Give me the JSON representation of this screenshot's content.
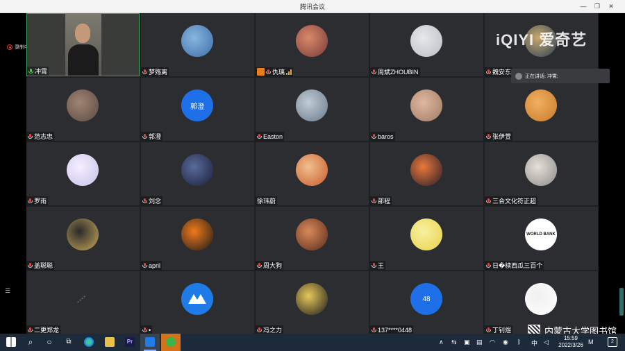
{
  "window": {
    "title": "腾讯会议"
  },
  "recording": {
    "label": "录制中"
  },
  "speaking": {
    "label": "正在讲话: 冲霄;"
  },
  "watermark": {
    "text": "iQIYI 爱奇艺"
  },
  "library": {
    "text": "内蒙古大学图书馆"
  },
  "participants": [
    {
      "name": "冲霄",
      "type": "video",
      "mic": "green"
    },
    {
      "name": "梦殇离",
      "type": "avatar",
      "color": "#3b6ea8",
      "color2": "#89b6e0"
    },
    {
      "name": "仇璃",
      "type": "avatar",
      "color": "#7a3a3a",
      "color2": "#d88a6a",
      "host": true,
      "signal": true
    },
    {
      "name": "周斌ZHOUBIN",
      "type": "avatar",
      "color": "#b9bec4",
      "color2": "#e6e8ea"
    },
    {
      "name": "魏安东",
      "type": "avatar",
      "color": "#2a3f5a",
      "color2": "#c8a86a"
    },
    {
      "name": "范志忠",
      "type": "avatar",
      "color": "#5a4a42",
      "color2": "#a08474"
    },
    {
      "name": "郭澄",
      "type": "text",
      "color": "#1e6fe8",
      "avatar_text": "郭澄"
    },
    {
      "name": "Easton",
      "type": "avatar",
      "color": "#6a7a8a",
      "color2": "#c0ccd6"
    },
    {
      "name": "baros",
      "type": "avatar",
      "color": "#a07a64",
      "color2": "#e0b8a0"
    },
    {
      "name": "张伊萱",
      "type": "avatar",
      "color": "#c87a2a",
      "color2": "#f0b060"
    },
    {
      "name": "罗雨",
      "type": "avatar",
      "color": "#c8c0e8",
      "color2": "#f4f0ff"
    },
    {
      "name": "刘念",
      "type": "avatar",
      "color": "#1a1f3a",
      "color2": "#5a6a9a"
    },
    {
      "name": "徐玮蔚",
      "type": "avatar",
      "color": "#c85a2a",
      "color2": "#f0c090",
      "nomic": true
    },
    {
      "name": "邵程",
      "type": "avatar",
      "color": "#2a1a2a",
      "color2": "#e87a3a"
    },
    {
      "name": "三合文化符正超",
      "type": "avatar",
      "color": "#8a8a8a",
      "color2": "#e8e0d8"
    },
    {
      "name": "盖聪聪",
      "type": "avatar",
      "color": "#caa85a",
      "color2": "#2a2a2a"
    },
    {
      "name": "april",
      "type": "avatar",
      "color": "#1a1a1a",
      "color2": "#f07a1a"
    },
    {
      "name": "周大狗",
      "type": "avatar",
      "color": "#5a2a1a",
      "color2": "#d88a5a"
    },
    {
      "name": "王",
      "type": "avatar",
      "color": "#e8d24a",
      "color2": "#f8f0a0"
    },
    {
      "name": "日�椟西瓜三百个",
      "type": "text-dark",
      "color": "#ffffff",
      "avatar_text": "WORLD BANK"
    },
    {
      "name": "二更郑龙",
      "type": "blank"
    },
    {
      "name": "•",
      "type": "logo",
      "color": "#1e7be8"
    },
    {
      "name": "冯之力",
      "type": "avatar",
      "color": "#1a1a1a",
      "color2": "#e8c85a"
    },
    {
      "name": "137****0448",
      "type": "text",
      "color": "#1e6fe8",
      "avatar_text": "48"
    },
    {
      "name": "丁钊煜",
      "type": "avatar",
      "color": "#ffffff",
      "color2": "#f0f0f0"
    }
  ],
  "taskbar": {
    "clock_time": "15:59",
    "clock_date": "2022/3/26",
    "ime": "中",
    "notification_count": "2"
  }
}
